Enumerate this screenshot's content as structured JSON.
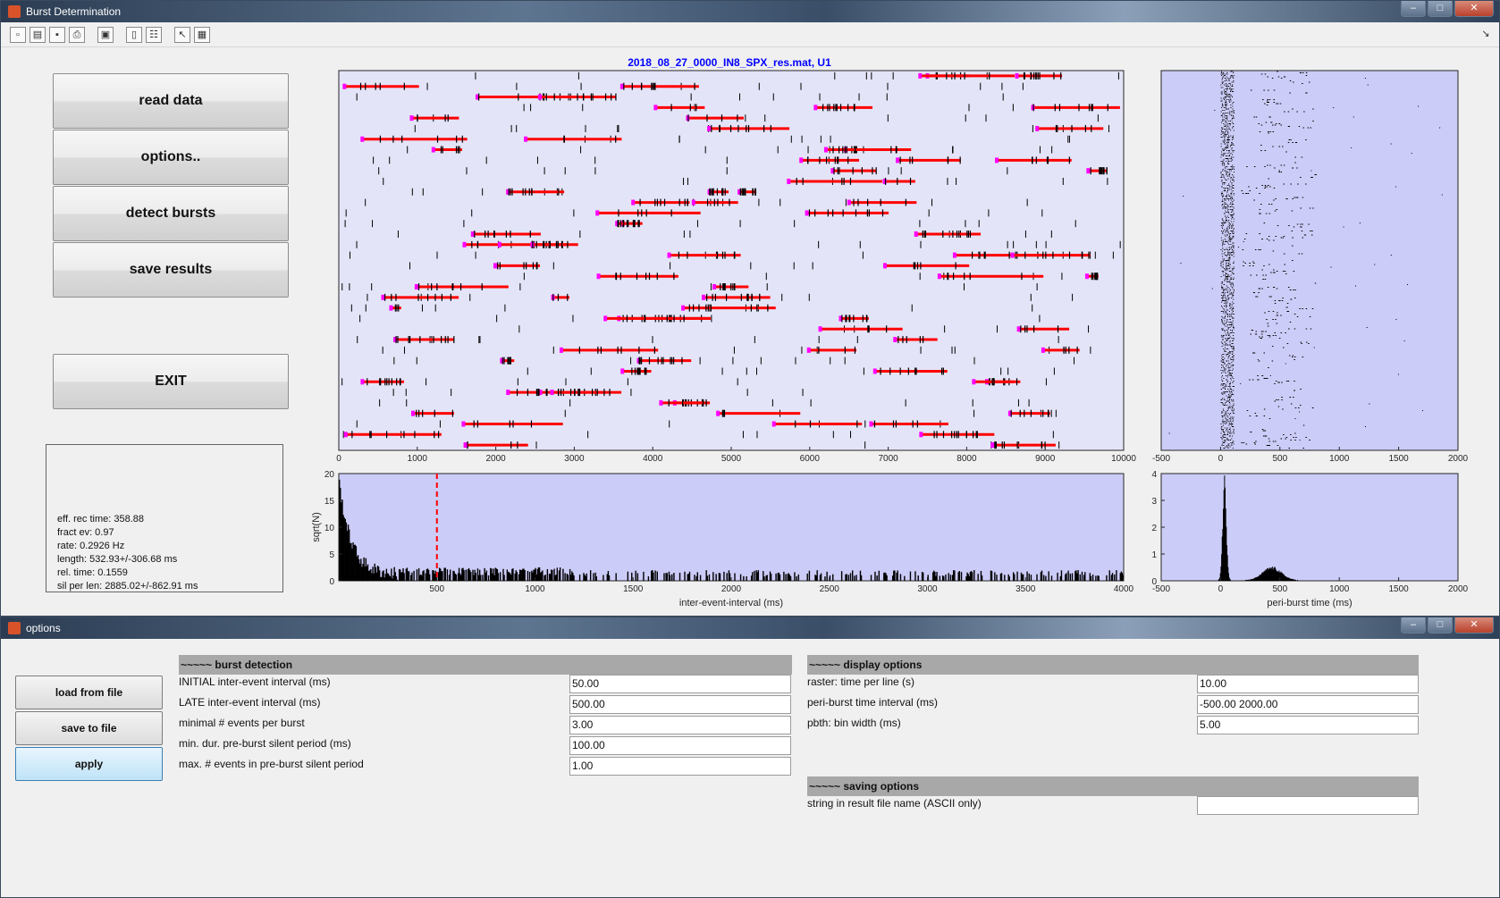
{
  "main_window": {
    "title": "Burst Determination",
    "buttons": {
      "read_data": "read data",
      "options": "options..",
      "detect_bursts": "detect bursts",
      "save_results": "save results",
      "exit": "EXIT"
    },
    "stats": [
      "eff. rec time: 358.88",
      "fract ev: 0.97",
      "rate: 0.2926 Hz",
      "length: 532.93+/-306.68 ms",
      "rel. time: 0.1559",
      "sil per len: 2885.02+/-862.91 ms"
    ],
    "colors": {
      "raster_bg": "#e4e4f8",
      "plot_bg": "#ccccf8",
      "burst": "#ff0000",
      "burst_edge": "#ff00ff",
      "title": "#0000ff"
    }
  },
  "chart_data": [
    {
      "type": "scatter",
      "title": "2018_08_27_0000_IN8_SPX_res.mat, U1",
      "xticks": [
        "0",
        "1000",
        "2000",
        "3000",
        "4000",
        "5000",
        "6000",
        "7000",
        "8000",
        "9000",
        "10000"
      ],
      "xlim": [
        0,
        10000
      ],
      "rows": 36
    },
    {
      "type": "scatter",
      "xticks": [
        "-500",
        "0",
        "500",
        "1000",
        "1500",
        "2000"
      ],
      "xlim": [
        -500,
        2000
      ]
    },
    {
      "type": "bar",
      "xlabel": "inter-event-interval (ms)",
      "ylabel": "sqrt(N)",
      "xticks": [
        "500",
        "1000",
        "1500",
        "2000",
        "2500",
        "3000",
        "3500",
        "4000"
      ],
      "yticks": [
        "0",
        "5",
        "10",
        "15",
        "20"
      ],
      "xlim": [
        0,
        4000
      ],
      "ylim": [
        0,
        20
      ],
      "threshold_line": 500
    },
    {
      "type": "bar",
      "xlabel": "peri-burst time (ms)",
      "xticks": [
        "-500",
        "0",
        "500",
        "1000",
        "1500",
        "2000"
      ],
      "yticks": [
        "0",
        "1",
        "2",
        "3",
        "4"
      ],
      "xlim": [
        -500,
        2000
      ],
      "ylim": [
        0,
        4
      ]
    }
  ],
  "options_window": {
    "title": "options",
    "buttons": {
      "load": "load from file",
      "save": "save to file",
      "apply": "apply"
    },
    "burst_detection": {
      "header": "~~~~~ burst detection",
      "fields": [
        {
          "label": "INITIAL inter-event interval (ms)",
          "value": "50.00"
        },
        {
          "label": "LATE inter-event interval (ms)",
          "value": "500.00"
        },
        {
          "label": "minimal # events per burst",
          "value": "3.00"
        },
        {
          "label": "min. dur. pre-burst silent period (ms)",
          "value": "100.00"
        },
        {
          "label": "max. # events in pre-burst silent period",
          "value": "1.00"
        }
      ]
    },
    "display_options": {
      "header": "~~~~~ display options",
      "fields": [
        {
          "label": "raster: time per line (s)",
          "value": "10.00"
        },
        {
          "label": "peri-burst time interval (ms)",
          "value": "-500.00 2000.00"
        },
        {
          "label": "pbth: bin width (ms)",
          "value": "5.00"
        }
      ]
    },
    "saving_options": {
      "header": "~~~~~ saving options",
      "fields": [
        {
          "label": "string in result file name (ASCII only)",
          "value": ""
        }
      ]
    }
  }
}
